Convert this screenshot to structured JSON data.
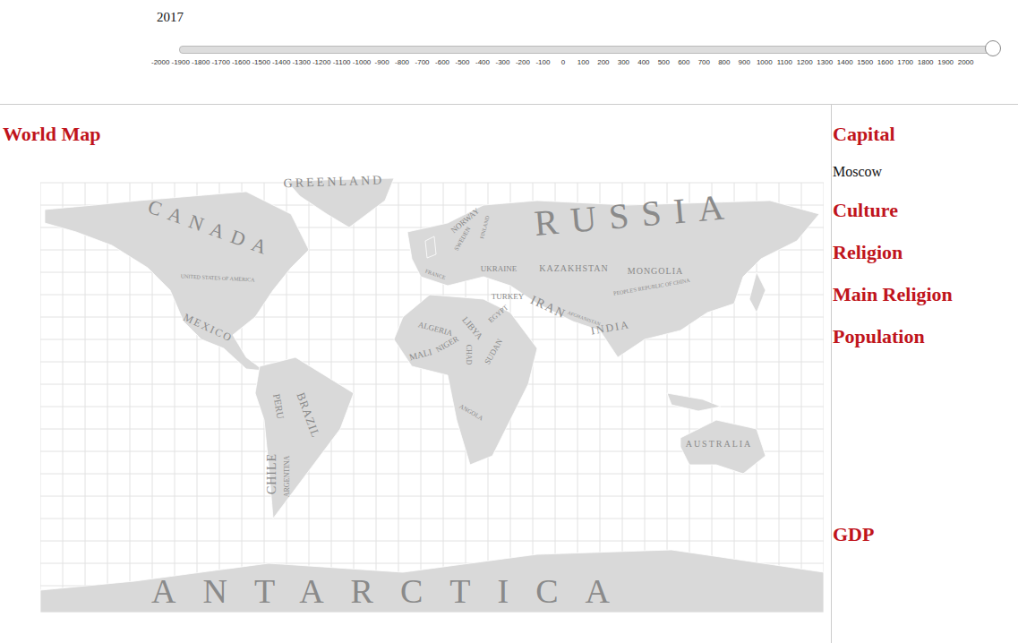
{
  "year": "2017",
  "slider": {
    "level": 1,
    "ticks": [
      "-2000",
      "-1900",
      "-1800",
      "-1700",
      "-1600",
      "-1500",
      "-1400",
      "-1300",
      "-1200",
      "-1100",
      "-1000",
      "-900",
      "-800",
      "-700",
      "-600",
      "-500",
      "-400",
      "-300",
      "-200",
      "-100",
      "0",
      "100",
      "200",
      "300",
      "400",
      "500",
      "600",
      "700",
      "800",
      "900",
      "1000",
      "1100",
      "1200",
      "1300",
      "1400",
      "1500",
      "1600",
      "1700",
      "1800",
      "1900",
      "2000"
    ]
  },
  "map": {
    "title": "World Map",
    "labels": [
      "GREENLAND",
      "CANADA",
      "RUSSIA",
      "NORWAY",
      "SWEDEN",
      "FINLAND",
      "UKRAINE",
      "KAZAKHSTAN",
      "MONGOLIA",
      "UNITED STATES OF AMERICA",
      "FRANCE",
      "PEOPLE'S REPUBLIC OF CHINA",
      "TURKEY",
      "IRAN",
      "AFGHANISTAN",
      "INDIA",
      "MEXICO",
      "ALGERIA",
      "LIBYA",
      "EGYPT",
      "MALI",
      "NIGER",
      "CHAD",
      "SUDAN",
      "ANGOLA",
      "PERU",
      "BRAZIL",
      "CHILE",
      "ARGENTINA",
      "AUSTRALIA",
      "ANTARCTICA"
    ]
  },
  "info": {
    "sections": [
      {
        "heading": "Capital",
        "value": "Moscow"
      },
      {
        "heading": "Culture",
        "value": ""
      },
      {
        "heading": "Religion",
        "value": ""
      },
      {
        "heading": "Main Religion",
        "value": ""
      },
      {
        "heading": "Population",
        "value": ""
      }
    ],
    "footer_heading": "GDP"
  }
}
